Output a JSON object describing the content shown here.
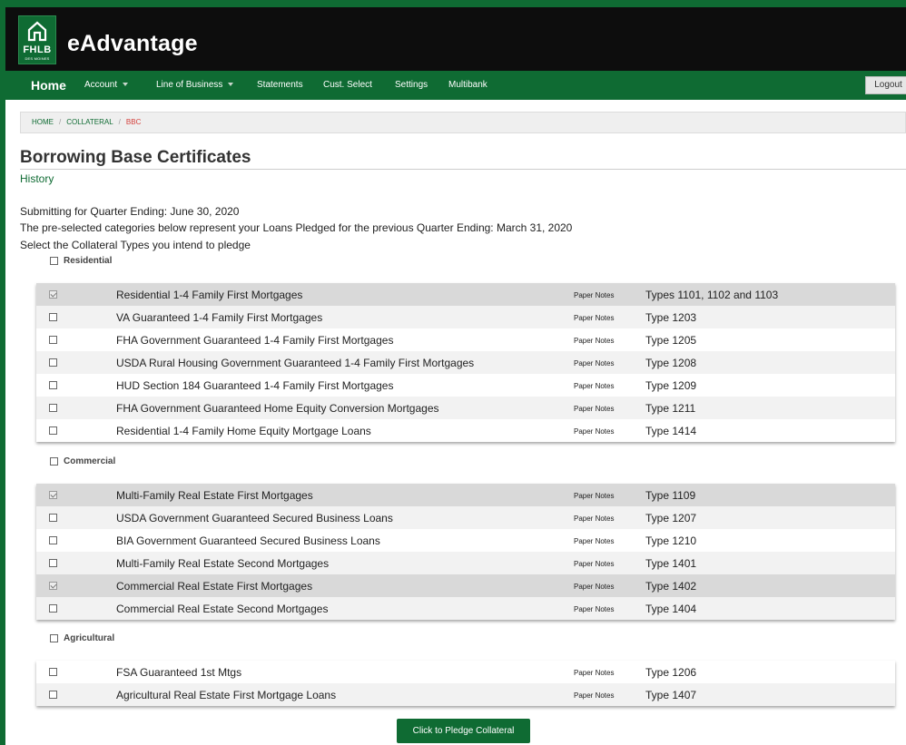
{
  "brand": {
    "logo_text": "FHLB",
    "logo_sub": "DES MOINES",
    "app_title": "eAdvantage"
  },
  "nav": {
    "home": "Home",
    "items": [
      "Account",
      "Line of Business",
      "Statements",
      "Cust. Select",
      "Settings",
      "Multibank"
    ],
    "logout": "Logout"
  },
  "breadcrumb": {
    "home": "HOME",
    "sep": "/",
    "collateral": "COLLATERAL",
    "current": "BBC"
  },
  "page": {
    "title": "Borrowing Base Certificates",
    "history": "History",
    "submitting": "Submitting for Quarter Ending: June 30, 2020",
    "preselected": "The pre-selected categories below represent your Loans Pledged for the previous Quarter Ending: March 31, 2020",
    "select_prompt": "Select the Collateral Types you intend to pledge"
  },
  "groups": [
    {
      "name": "Residential",
      "rows": [
        {
          "checked": true,
          "desc": "Residential 1-4 Family First Mortgages",
          "ptype": "Paper Notes",
          "code": "Types 1101, 1102 and 1103"
        },
        {
          "checked": false,
          "desc": "VA Guaranteed 1-4 Family First Mortgages",
          "ptype": "Paper Notes",
          "code": "Type 1203"
        },
        {
          "checked": false,
          "desc": "FHA Government Guaranteed 1-4 Family First Mortgages",
          "ptype": "Paper Notes",
          "code": "Type 1205"
        },
        {
          "checked": false,
          "desc": "USDA Rural Housing Government Guaranteed 1-4 Family First Mortgages",
          "ptype": "Paper Notes",
          "code": "Type 1208"
        },
        {
          "checked": false,
          "desc": "HUD Section 184 Guaranteed 1-4 Family First Mortgages",
          "ptype": "Paper Notes",
          "code": "Type 1209"
        },
        {
          "checked": false,
          "desc": "FHA Government Guaranteed Home Equity Conversion Mortgages",
          "ptype": "Paper Notes",
          "code": "Type 1211"
        },
        {
          "checked": false,
          "desc": "Residential 1-4 Family Home Equity Mortgage Loans",
          "ptype": "Paper Notes",
          "code": "Type 1414"
        }
      ]
    },
    {
      "name": "Commercial",
      "rows": [
        {
          "checked": true,
          "desc": "Multi-Family Real Estate First Mortgages",
          "ptype": "Paper Notes",
          "code": "Type 1109"
        },
        {
          "checked": false,
          "desc": "USDA Government Guaranteed Secured Business Loans",
          "ptype": "Paper Notes",
          "code": "Type 1207"
        },
        {
          "checked": false,
          "desc": "BIA Government Guaranteed Secured Business Loans",
          "ptype": "Paper Notes",
          "code": "Type 1210"
        },
        {
          "checked": false,
          "desc": "Multi-Family Real Estate Second Mortgages",
          "ptype": "Paper Notes",
          "code": "Type 1401"
        },
        {
          "checked": true,
          "desc": "Commercial Real Estate First Mortgages",
          "ptype": "Paper Notes",
          "code": "Type 1402"
        },
        {
          "checked": false,
          "desc": "Commercial Real Estate Second Mortgages",
          "ptype": "Paper Notes",
          "code": "Type 1404"
        }
      ]
    },
    {
      "name": "Agricultural",
      "rows": [
        {
          "checked": false,
          "desc": "FSA Guaranteed 1st Mtgs",
          "ptype": "Paper Notes",
          "code": "Type 1206"
        },
        {
          "checked": false,
          "desc": "Agricultural Real Estate First Mortgage Loans",
          "ptype": "Paper Notes",
          "code": "Type 1407"
        }
      ]
    }
  ],
  "pledge_button": "Click to Pledge Collateral",
  "colors": {
    "brand_green": "#0f6b33",
    "header_black": "#0d0d0d",
    "breadcrumb_current": "#d43f3a"
  }
}
